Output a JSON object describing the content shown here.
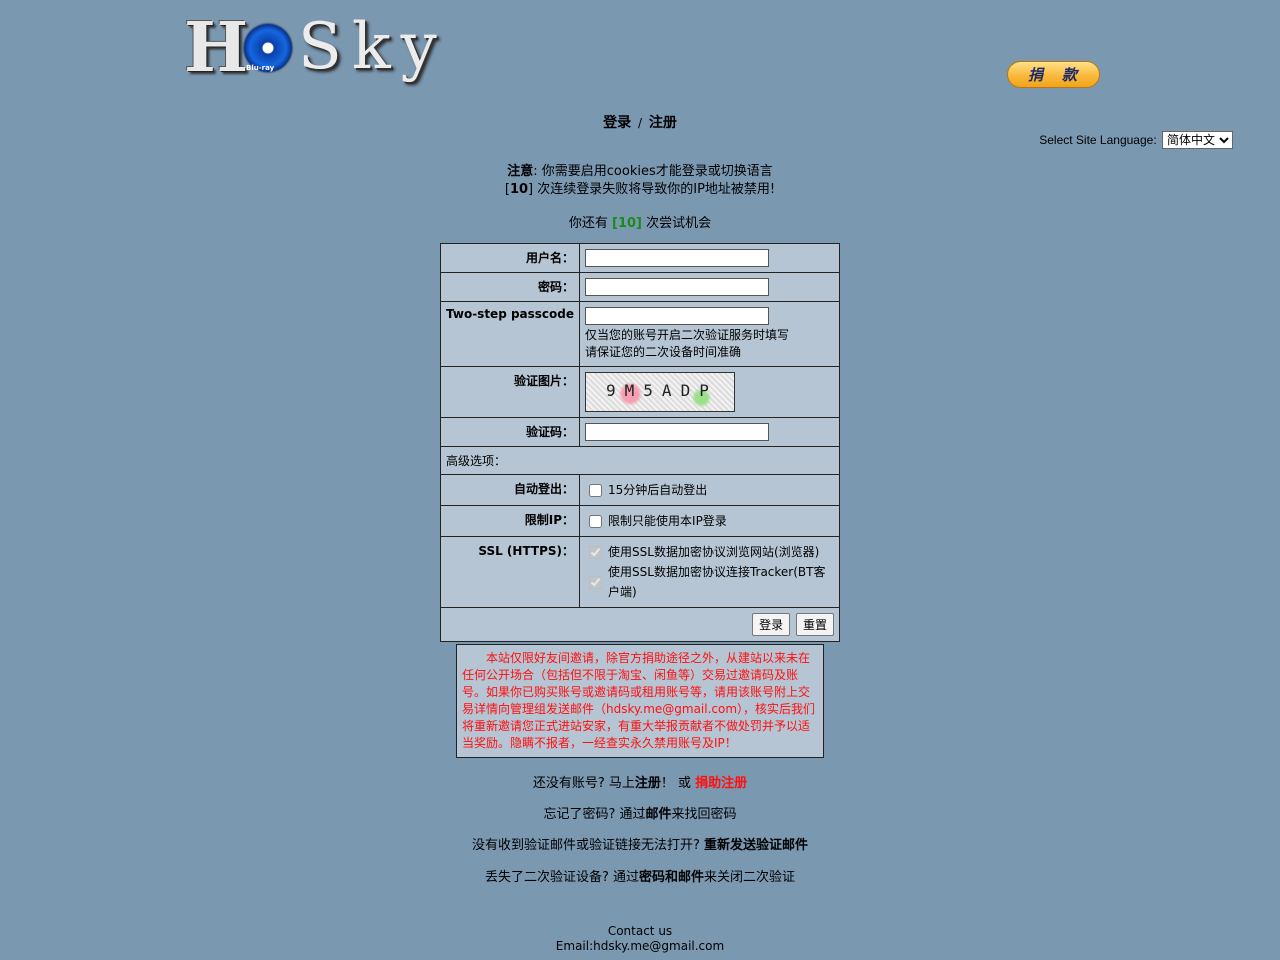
{
  "header": {
    "logo_h": "H",
    "logo_disc_label": "Blu-ray",
    "logo_sky": "Sky",
    "donate_label": "捐　款"
  },
  "title": {
    "login": "登录",
    "separator": "/",
    "register": "注册"
  },
  "language": {
    "label": "Select Site Language:",
    "selected": "简体中文"
  },
  "notes": {
    "note_label": "注意",
    "note_text": ": 你需要启用cookies才能登录或切换语言",
    "limit_prefix": "[",
    "limit_number": "10",
    "limit_text": "] 次连续登录失败将导致你的IP地址被禁用!"
  },
  "attempts": {
    "prefix": "你还有",
    "count": "[10]",
    "suffix": "次尝试机会"
  },
  "form": {
    "username_label": "用户名：",
    "username_value": "",
    "password_label": "密码：",
    "password_value": "",
    "twostep_label": "Two-step passcode",
    "twostep_value": "",
    "twostep_hint1": "仅当您的账号开启二次验证服务时填写",
    "twostep_hint2": "请保证您的二次设备时间准确",
    "captcha_label": "验证图片：",
    "captcha_code": "9M5ADP",
    "captcha_input_label": "验证码：",
    "captcha_input_value": "",
    "advanced_label": "高级选项：",
    "autologout_label": "自动登出：",
    "autologout_text": "15分钟后自动登出",
    "limitip_label": "限制IP：",
    "limitip_text": "限制只能使用本IP登录",
    "ssl_label": "SSL (HTTPS)：",
    "ssl_browse_text": "使用SSL数据加密协议浏览网站(浏览器)",
    "ssl_tracker_text": "使用SSL数据加密协议连接Tracker(BT客户端)",
    "login_button": "登录",
    "reset_button": "重置"
  },
  "warning": {
    "text": "本站仅限好友间邀请，除官方捐助途径之外，从建站以来未在任何公开场合（包括但不限于淘宝、闲鱼等）交易过邀请码及账号。如果你已购买账号或邀请码或租用账号等，请用该账号附上交易详情向管理组发送邮件（hdsky.me@gmail.com），核实后我们将重新邀请您正式进站安家，有重大举报贡献者不做处罚并予以适当奖励。隐瞒不报者，一经查实永久禁用账号及IP！"
  },
  "links": {
    "signup_prefix": "还没有账号? 马上",
    "signup_link": "注册",
    "signup_mid": "！ 或",
    "donate_signup": "捐助注册",
    "forgot_prefix": "忘记了密码? 通过",
    "forgot_link": "邮件",
    "forgot_suffix": "来找回密码",
    "resend_prefix": "没有收到验证邮件或验证链接无法打开?",
    "resend_link": "重新发送验证邮件",
    "lost2fa_prefix": "丢失了二次验证设备? 通过",
    "lost2fa_link": "密码和邮件",
    "lost2fa_suffix": "来关闭二次验证"
  },
  "footer": {
    "contact": "Contact us",
    "email": "Email:hdsky.me@gmail.com"
  },
  "colors": {
    "background": "#7b98b1",
    "panel": "#b6c5d3",
    "warning_text": "#ff1010",
    "attempts_count": "#1a8a1a"
  }
}
